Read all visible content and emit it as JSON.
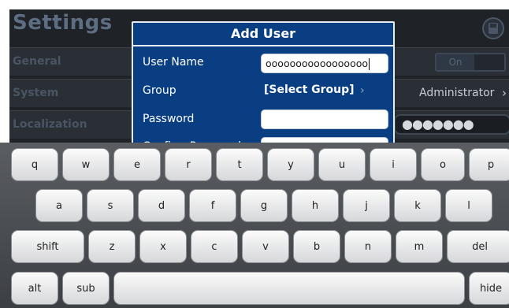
{
  "background": {
    "title": "Settings",
    "rows": [
      {
        "label": "General"
      },
      {
        "label": "System"
      },
      {
        "label": "Localization"
      }
    ],
    "toggle_label": "On",
    "group_value": "Administrator",
    "chevron": "›",
    "password_mask": "●●●●●●●",
    "save_icon": "save-icon"
  },
  "dialog": {
    "title": "Add User",
    "username_label": "User Name",
    "username_value": "ooooooooooooooooo",
    "group_label": "Group",
    "group_value": "[Select Group]",
    "group_chevron": "›",
    "password_label": "Password",
    "password_value": "",
    "confirm_label": "Confirm Password",
    "confirm_value": ""
  },
  "keyboard": {
    "row1": [
      "q",
      "w",
      "e",
      "r",
      "t",
      "y",
      "u",
      "i",
      "o",
      "p"
    ],
    "row2": [
      "a",
      "s",
      "d",
      "f",
      "g",
      "h",
      "j",
      "k",
      "l"
    ],
    "row3": [
      "shift",
      "z",
      "x",
      "c",
      "v",
      "b",
      "n",
      "m",
      "del"
    ],
    "row4": [
      "alt",
      "sub",
      "",
      "hide"
    ]
  },
  "colors": {
    "dialog_blue": "#0a3e82",
    "dim_background": "#1f2328"
  }
}
